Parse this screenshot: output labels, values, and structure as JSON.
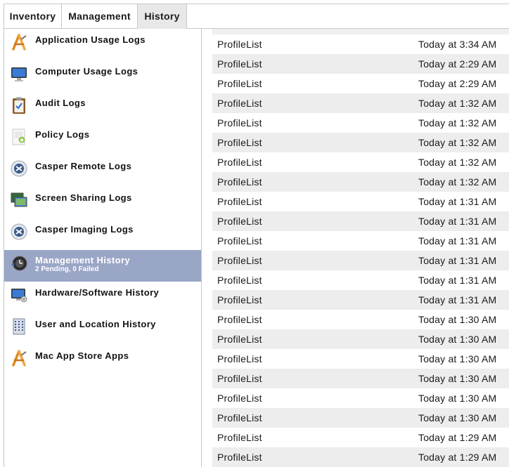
{
  "tabs": [
    {
      "label": "Inventory"
    },
    {
      "label": "Management"
    },
    {
      "label": "History"
    }
  ],
  "sidebar": {
    "items": [
      {
        "label": "Application Usage Logs",
        "icon": "app-store-a-icon"
      },
      {
        "label": "Computer Usage Logs",
        "icon": "monitor-icon"
      },
      {
        "label": "Audit Logs",
        "icon": "clipboard-icon"
      },
      {
        "label": "Policy Logs",
        "icon": "policy-document-icon"
      },
      {
        "label": "Casper Remote Logs",
        "icon": "casper-remote-icon"
      },
      {
        "label": "Screen Sharing Logs",
        "icon": "screen-sharing-icon"
      },
      {
        "label": "Casper Imaging Logs",
        "icon": "casper-imaging-icon"
      },
      {
        "label": "Management History",
        "sublabel": "2 Pending, 0 Failed",
        "icon": "management-history-icon",
        "selected": true
      },
      {
        "label": "Hardware/Software History",
        "icon": "hardware-monitor-icon"
      },
      {
        "label": "User and Location History",
        "icon": "building-icon"
      },
      {
        "label": "Mac App Store Apps",
        "icon": "app-store-a-icon"
      }
    ]
  },
  "rows": [
    {
      "name": "ProfileList",
      "date": "Today at 3:34 AM"
    },
    {
      "name": "ProfileList",
      "date": "Today at 2:29 AM"
    },
    {
      "name": "ProfileList",
      "date": "Today at 2:29 AM"
    },
    {
      "name": "ProfileList",
      "date": "Today at 1:32 AM"
    },
    {
      "name": "ProfileList",
      "date": "Today at 1:32 AM"
    },
    {
      "name": "ProfileList",
      "date": "Today at 1:32 AM"
    },
    {
      "name": "ProfileList",
      "date": "Today at 1:32 AM"
    },
    {
      "name": "ProfileList",
      "date": "Today at 1:32 AM"
    },
    {
      "name": "ProfileList",
      "date": "Today at 1:31 AM"
    },
    {
      "name": "ProfileList",
      "date": "Today at 1:31 AM"
    },
    {
      "name": "ProfileList",
      "date": "Today at 1:31 AM"
    },
    {
      "name": "ProfileList",
      "date": "Today at 1:31 AM"
    },
    {
      "name": "ProfileList",
      "date": "Today at 1:31 AM"
    },
    {
      "name": "ProfileList",
      "date": "Today at 1:31 AM"
    },
    {
      "name": "ProfileList",
      "date": "Today at 1:30 AM"
    },
    {
      "name": "ProfileList",
      "date": "Today at 1:30 AM"
    },
    {
      "name": "ProfileList",
      "date": "Today at 1:30 AM"
    },
    {
      "name": "ProfileList",
      "date": "Today at 1:30 AM"
    },
    {
      "name": "ProfileList",
      "date": "Today at 1:30 AM"
    },
    {
      "name": "ProfileList",
      "date": "Today at 1:30 AM"
    },
    {
      "name": "ProfileList",
      "date": "Today at 1:29 AM"
    },
    {
      "name": "ProfileList",
      "date": "Today at 1:29 AM"
    }
  ]
}
